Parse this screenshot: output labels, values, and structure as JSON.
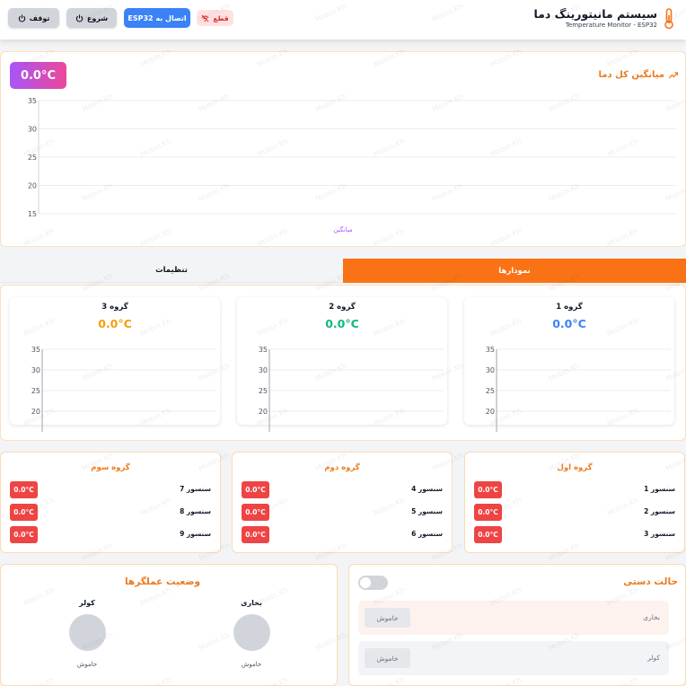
{
  "header": {
    "title": "سیستم مانیتورینگ دما",
    "subtitle": "Temperature Monitor - ESP32",
    "stop_label": "توقف",
    "start_label": "شروع",
    "connect_label": "اتصال به ESP32",
    "status_label": "قطع"
  },
  "average": {
    "title": "میانگین کل دما",
    "value": "0.0°C",
    "legend": "میانگین"
  },
  "tabs": [
    {
      "label": "نمودارها",
      "active": true
    },
    {
      "label": "تنظیمات",
      "active": false
    }
  ],
  "groups": [
    {
      "title": "گروه 1",
      "value": "0.0°C",
      "color": "#3b82f6"
    },
    {
      "title": "گروه 2",
      "value": "0.0°C",
      "color": "#10b981"
    },
    {
      "title": "گروه 3",
      "value": "0.0°C",
      "color": "#f59e0b"
    }
  ],
  "sensor_groups": [
    {
      "title": "گروه اول",
      "sensors": [
        {
          "label": "سنسور 1",
          "value": "0.0°C"
        },
        {
          "label": "سنسور 2",
          "value": "0.0°C"
        },
        {
          "label": "سنسور 3",
          "value": "0.0°C"
        }
      ]
    },
    {
      "title": "گروه دوم",
      "sensors": [
        {
          "label": "سنسور 4",
          "value": "0.0°C"
        },
        {
          "label": "سنسور 5",
          "value": "0.0°C"
        },
        {
          "label": "سنسور 6",
          "value": "0.0°C"
        }
      ]
    },
    {
      "title": "گروه سوم",
      "sensors": [
        {
          "label": "سنسور 7",
          "value": "0.0°C"
        },
        {
          "label": "سنسور 8",
          "value": "0.0°C"
        },
        {
          "label": "سنسور 9",
          "value": "0.0°C"
        }
      ]
    }
  ],
  "manual": {
    "title": "حالت دستی",
    "rows": [
      {
        "label": "بخاری",
        "button": "خاموش"
      },
      {
        "label": "کولر",
        "button": "خاموش"
      }
    ]
  },
  "actuators": {
    "title": "وضعیت عملگرها",
    "items": [
      {
        "name": "بخاری",
        "state": "خاموش"
      },
      {
        "name": "کولر",
        "state": "خاموش"
      }
    ]
  },
  "avg_chart": {
    "yticks": [
      "35",
      "30",
      "25",
      "20",
      "15"
    ]
  },
  "group_chart": {
    "yticks": [
      "35",
      "30",
      "25",
      "20"
    ]
  },
  "watermark": "Mobin.Kh",
  "colors": {
    "accent": "#f97316",
    "primary": "#3b82f6",
    "danger": "#ef4444"
  }
}
